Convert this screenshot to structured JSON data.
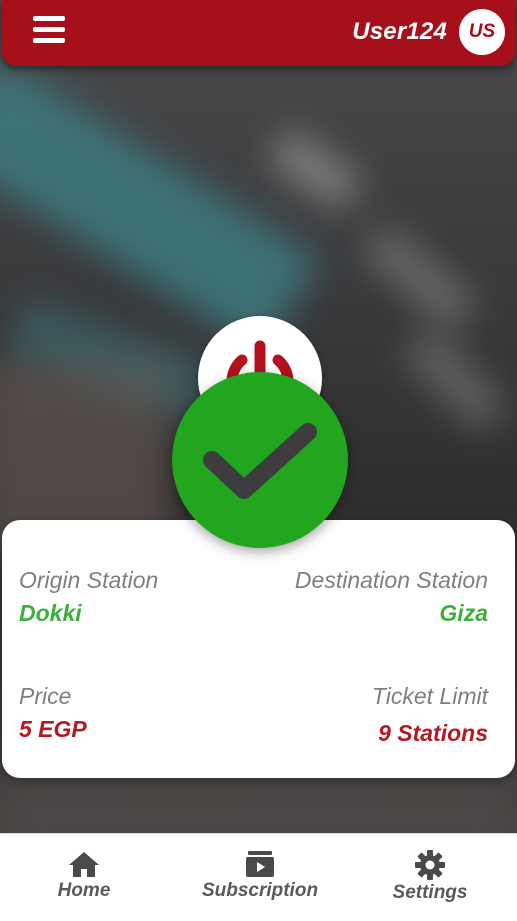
{
  "header": {
    "menu_icon": "hamburger-menu-icon",
    "username": "User124",
    "avatar_initials": "US",
    "background_color": "#a5101a"
  },
  "status": {
    "power_icon": "power-icon",
    "success_icon": "checkmark-icon",
    "success_color": "#21a61d"
  },
  "ticket": {
    "origin_label": "Origin Station",
    "origin_value": "Dokki",
    "destination_label": "Destination Station",
    "destination_value": "Giza",
    "price_label": "Price",
    "price_value": "5 EGP",
    "limit_label": "Ticket Limit",
    "limit_value": "9 Stations",
    "green_color": "#3cb03a",
    "red_color": "#b21a24"
  },
  "nav": {
    "items": [
      {
        "label": "Home",
        "icon": "home-icon"
      },
      {
        "label": "Subscription",
        "icon": "subscription-icon"
      },
      {
        "label": "Settings",
        "icon": "gear-icon"
      }
    ]
  }
}
